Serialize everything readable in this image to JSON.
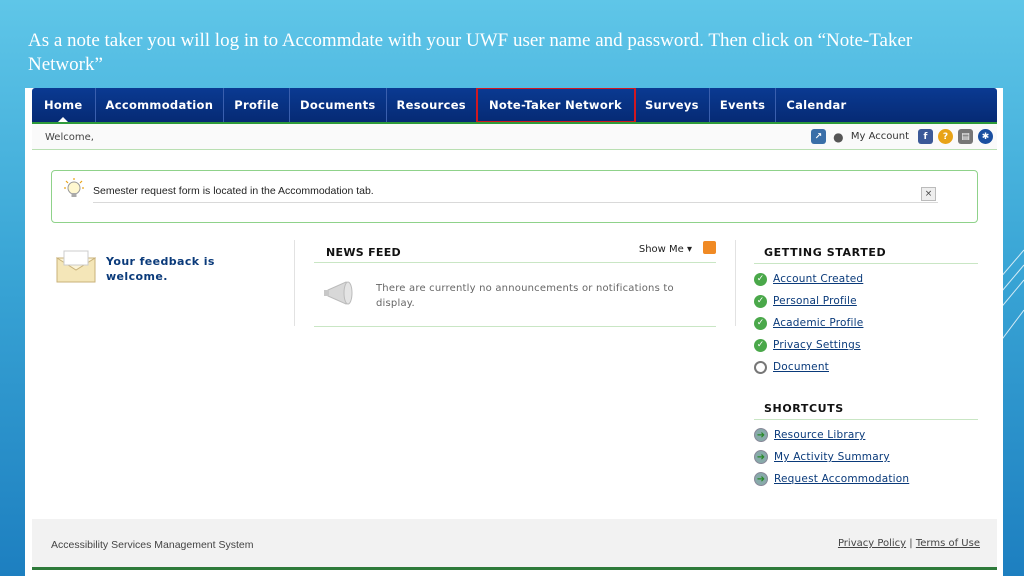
{
  "slide": {
    "caption": "As a note taker you will log in to Accommdate with your UWF user name and password. Then click on “Note-Taker Network”"
  },
  "nav": {
    "items": [
      "Home",
      "Accommodation",
      "Profile",
      "Documents",
      "Resources",
      "Note-Taker Network",
      "Surveys",
      "Events",
      "Calendar"
    ],
    "highlighted": "Note-Taker Network"
  },
  "welcome": {
    "text": "Welcome,",
    "my_account": "My Account",
    "icons": [
      "external-window-icon",
      "user-icon",
      "facebook-icon",
      "help-icon",
      "print-icon",
      "accessibility-icon"
    ]
  },
  "alert": {
    "message": "Semester request form is located in the Accommodation tab.",
    "close": "×",
    "icon": "lightbulb-icon"
  },
  "feedback": {
    "text_line1": "Your feedback is",
    "text_line2": "welcome."
  },
  "news": {
    "title": "NEWS FEED",
    "show_me": "Show Me ▾",
    "empty_line1": "There are currently no announcements or notifications to",
    "empty_line2": "display."
  },
  "getting_started": {
    "title": "GETTING STARTED",
    "items": [
      {
        "label": "Account Created",
        "done": true
      },
      {
        "label": "Personal Profile",
        "done": true
      },
      {
        "label": "Academic Profile",
        "done": true
      },
      {
        "label": "Privacy Settings",
        "done": true
      },
      {
        "label": "Document",
        "done": false
      }
    ]
  },
  "shortcuts": {
    "title": "SHORTCUTS",
    "items": [
      "Resource Library",
      "My Activity Summary",
      "Request Accommodation"
    ]
  },
  "footer": {
    "system_name": "Accessibility Services Management System",
    "privacy": "Privacy Policy",
    "separator": "|",
    "terms": "Terms of Use"
  },
  "colors": {
    "nav_bg": "#062a74",
    "highlight_border": "#d01820",
    "green_rule": "#2e9a3a",
    "link": "#0a3a7a"
  }
}
